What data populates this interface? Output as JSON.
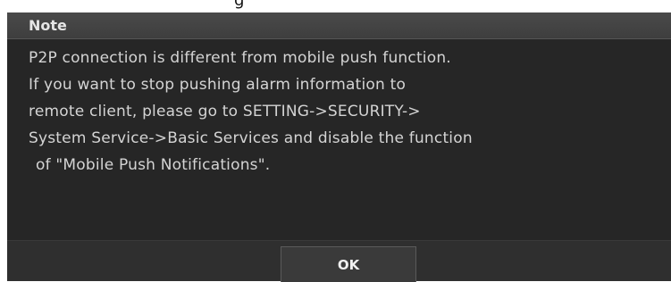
{
  "dialog": {
    "title": "Note",
    "message_lines": [
      "P2P connection is different from mobile push function.",
      "If you want to stop pushing alarm information to",
      "remote client, please go to SETTING->SECURITY->",
      "System Service->Basic Services and disable the function",
      "of \"Mobile Push Notifications\"."
    ],
    "ok_label": "OK"
  },
  "colors": {
    "dialog_background": "#262626",
    "titlebar_background": "#444444",
    "text": "#d4d4d4",
    "title_text": "#e6e6e6"
  }
}
